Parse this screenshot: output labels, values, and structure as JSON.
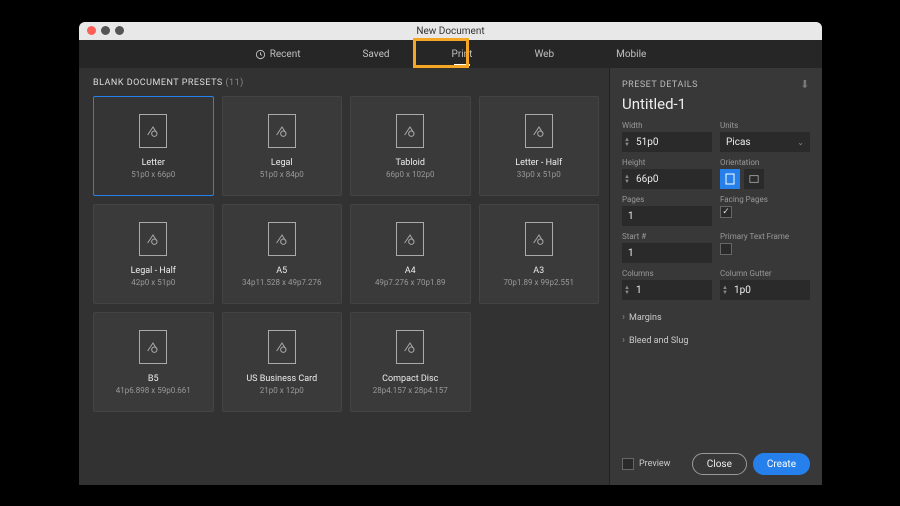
{
  "title": "New Document",
  "tabs": {
    "recent": "Recent",
    "saved": "Saved",
    "print": "Print",
    "web": "Web",
    "mobile": "Mobile"
  },
  "section": {
    "title": "BLANK DOCUMENT PRESETS",
    "count": "(11)"
  },
  "presets": [
    {
      "name": "Letter",
      "dims": "51p0 x 66p0"
    },
    {
      "name": "Legal",
      "dims": "51p0 x 84p0"
    },
    {
      "name": "Tabloid",
      "dims": "66p0 x 102p0"
    },
    {
      "name": "Letter - Half",
      "dims": "33p0 x 51p0"
    },
    {
      "name": "Legal - Half",
      "dims": "42p0 x 51p0"
    },
    {
      "name": "A5",
      "dims": "34p11.528 x 49p7.276"
    },
    {
      "name": "A4",
      "dims": "49p7.276 x 70p1.89"
    },
    {
      "name": "A3",
      "dims": "70p1.89 x 99p2.551"
    },
    {
      "name": "B5",
      "dims": "41p6.898 x 59p0.661"
    },
    {
      "name": "US Business Card",
      "dims": "21p0 x 12p0"
    },
    {
      "name": "Compact Disc",
      "dims": "28p4.157 x 28p4.157"
    }
  ],
  "details": {
    "header": "PRESET DETAILS",
    "docName": "Untitled-1",
    "widthLabel": "Width",
    "width": "51p0",
    "unitsLabel": "Units",
    "units": "Picas",
    "heightLabel": "Height",
    "height": "66p0",
    "orientationLabel": "Orientation",
    "pagesLabel": "Pages",
    "pages": "1",
    "facingLabel": "Facing Pages",
    "startLabel": "Start #",
    "start": "1",
    "primaryLabel": "Primary Text Frame",
    "columnsLabel": "Columns",
    "columns": "1",
    "gutterLabel": "Column Gutter",
    "gutter": "1p0",
    "margins": "Margins",
    "bleed": "Bleed and Slug",
    "preview": "Preview",
    "close": "Close",
    "create": "Create"
  }
}
